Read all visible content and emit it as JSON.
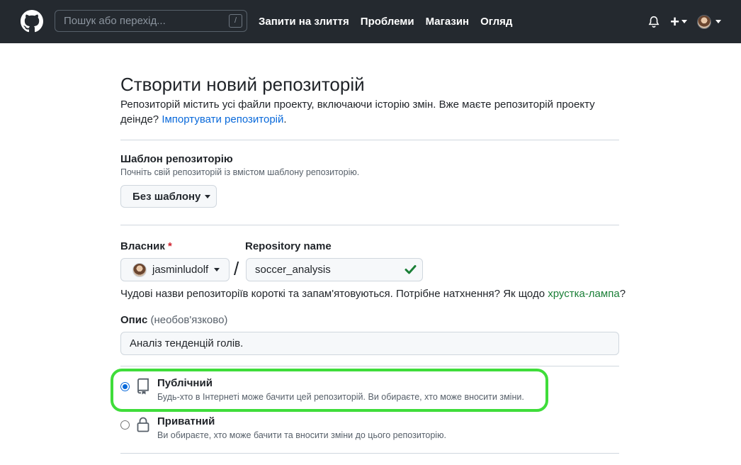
{
  "header": {
    "search_placeholder": "Пошук або перехід...",
    "search_shortcut": "/",
    "nav": [
      "Запити на злиття",
      "Проблеми",
      "Магазин",
      "Огляд"
    ],
    "plus_symbol": "+"
  },
  "page": {
    "title": "Створити новий репозиторій",
    "description": "Репозиторій містить усі файли проекту, включаючи історію змін. Вже маєте репозиторій проекту деінде? ",
    "import_link": "Імпортувати репозиторій",
    "description_end": "."
  },
  "template": {
    "label": "Шаблон репозиторію",
    "hint": "Почніть свій репозиторій із вмістом шаблону репозиторію.",
    "button": "Без шаблону"
  },
  "owner": {
    "label": "Власник",
    "required_mark": "*",
    "value": "jasminludolf"
  },
  "repository": {
    "label": "Repository name",
    "separator": "/",
    "value": "soccer_analysis",
    "valid": true,
    "hint_prefix": "Чудові назви репозиторіїв короткі та запам'ятовуються. Потрібне натхнення? Як щодо ",
    "suggestion": "хрустка-лампа",
    "hint_suffix": "?"
  },
  "description": {
    "label": "Опис",
    "optional": "(необов'язково)",
    "value": "Аналіз тенденцій голів."
  },
  "visibility": {
    "selected": "public",
    "options": [
      {
        "id": "public",
        "title": "Публічний",
        "subtitle": "Будь-хто в Інтернеті може бачити цей репозиторій. Ви обираєте, хто може вносити зміни.",
        "icon": "repo-icon"
      },
      {
        "id": "private",
        "title": "Приватний",
        "subtitle": "Ви обираєте, хто може бачити та вносити зміни до цього репозиторію.",
        "icon": "lock-icon"
      }
    ]
  },
  "colors": {
    "header_bg": "#24292f",
    "link": "#0969da",
    "success": "#1a7f37",
    "highlight": "#3fdd3a"
  }
}
